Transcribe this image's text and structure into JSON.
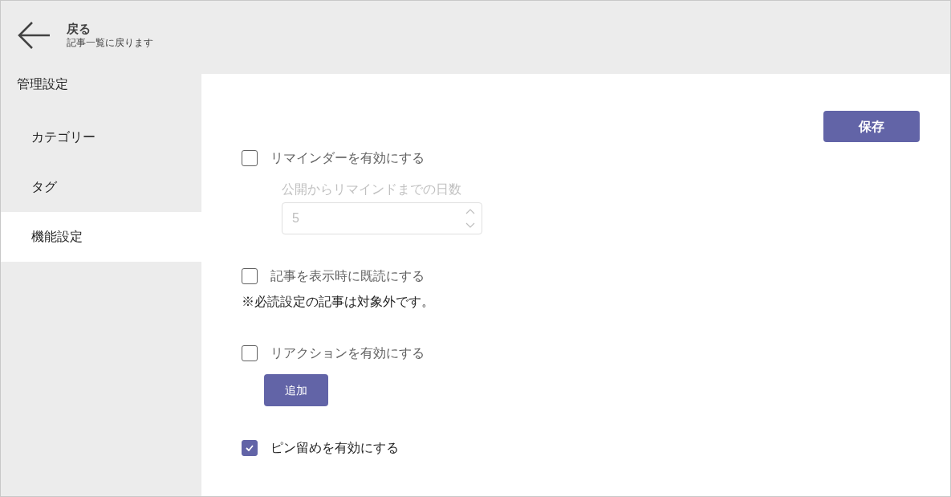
{
  "header": {
    "title": "戻る",
    "subtitle": "記事一覧に戻ります"
  },
  "sidebar": {
    "heading": "管理設定",
    "items": [
      {
        "label": "カテゴリー",
        "selected": false
      },
      {
        "label": "タグ",
        "selected": false
      },
      {
        "label": "機能設定",
        "selected": true
      }
    ]
  },
  "save_button": "保存",
  "settings": [
    {
      "label": "リマインダーを有効にする",
      "checked": false,
      "field": {
        "label": "公開からリマインドまでの日数",
        "value": "5",
        "disabled": true
      }
    },
    {
      "label": "記事を表示時に既読にする",
      "checked": false,
      "note": "※必読設定の記事は対象外です。"
    },
    {
      "label": "リアクションを有効にする",
      "checked": false,
      "button": "追加"
    },
    {
      "label": "ピン留めを有効にする",
      "checked": true
    }
  ]
}
